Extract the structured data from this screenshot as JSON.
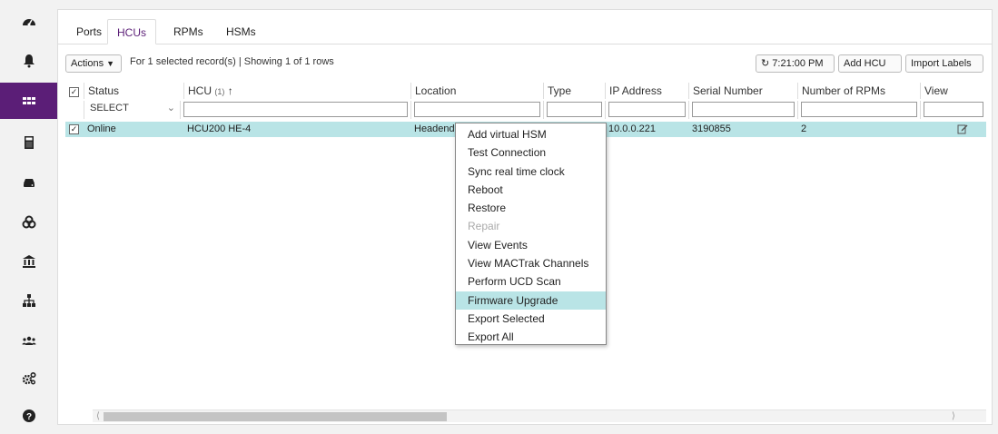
{
  "sidebar": {
    "items": [
      {
        "icon": "dashboard-icon"
      },
      {
        "icon": "bell-icon"
      },
      {
        "icon": "grid-icon",
        "active": true
      },
      {
        "icon": "calculator-icon"
      },
      {
        "icon": "hard-drive-icon"
      },
      {
        "icon": "biohazard-icon"
      },
      {
        "icon": "bank-icon"
      },
      {
        "icon": "sitemap-icon"
      },
      {
        "icon": "users-icon"
      },
      {
        "icon": "cogs-icon"
      },
      {
        "icon": "help-icon"
      }
    ]
  },
  "tabs": [
    "Ports",
    "HCUs",
    "RPMs",
    "HSMs"
  ],
  "active_tab": "HCUs",
  "toolbar": {
    "actions_label": "Actions",
    "status_text": "For 1 selected record(s) | Showing 1 of 1 rows",
    "refresh_time": "7:21:00 PM",
    "add_label": "Add HCU",
    "import_label": "Import Labels"
  },
  "table": {
    "columns": [
      "Status",
      "HCU",
      "Location",
      "Type",
      "IP Address",
      "Serial Number",
      "Number of RPMs",
      "View"
    ],
    "sort_indicator": "(1)",
    "status_filter": "SELECT",
    "rows": [
      {
        "status": "Online",
        "hcu": "HCU200 HE-4",
        "location": "Headend",
        "type": "",
        "ip": "10.0.0.221",
        "serial": "3190855",
        "rpms": "2"
      }
    ]
  },
  "context_menu": {
    "items": [
      {
        "label": "Add virtual HSM"
      },
      {
        "label": "Test Connection"
      },
      {
        "label": "Sync real time clock"
      },
      {
        "label": "Reboot"
      },
      {
        "label": "Restore"
      },
      {
        "label": "Repair",
        "disabled": true
      },
      {
        "label": "View Events"
      },
      {
        "label": "View MACTrak Channels"
      },
      {
        "label": "Perform UCD Scan"
      },
      {
        "label": "Firmware Upgrade",
        "highlighted": true
      },
      {
        "label": "Export Selected"
      },
      {
        "label": "Export All"
      }
    ]
  },
  "colors": {
    "accent": "#5b1e77",
    "selection": "#b9e4e6"
  }
}
